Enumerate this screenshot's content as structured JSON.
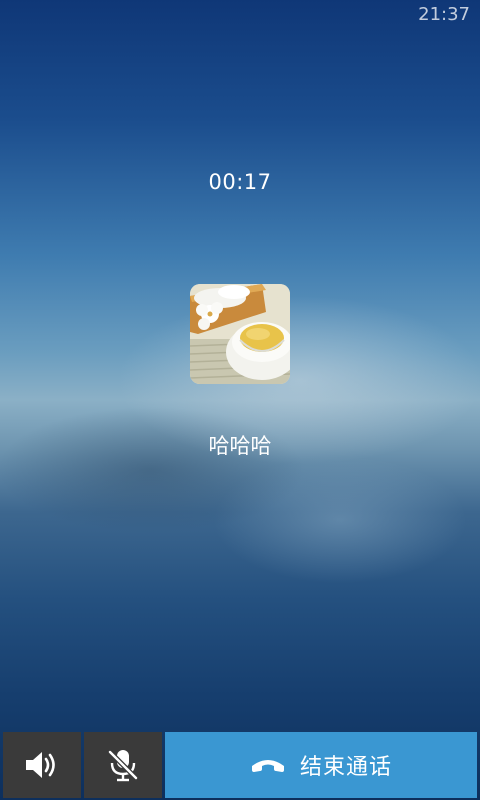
{
  "status_bar": {
    "time": "21:37"
  },
  "call": {
    "timer": "00:17",
    "contact_name": "哈哈哈"
  },
  "controls": {
    "speaker_icon": "speaker-icon",
    "mute_icon": "microphone-muted-icon",
    "hangup_icon": "phone-hangup-icon",
    "hangup_label": "结束通话",
    "hangup_color": "#3a97d2",
    "button_bg": "#3a3a3a"
  }
}
